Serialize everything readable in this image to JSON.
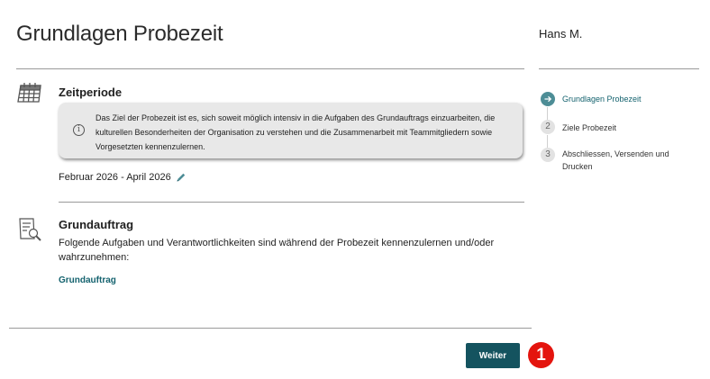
{
  "header": {
    "title": "Grundlagen Probezeit",
    "user": "Hans M."
  },
  "sections": {
    "period": {
      "heading": "Zeitperiode",
      "icon": "calendar-icon",
      "info_text": "Das Ziel der Probezeit ist es, sich soweit möglich intensiv in die Aufgaben des Grundauftrags einzuarbeiten, die kulturellen Besonderheiten der Organisation zu verstehen und die Zusammenarbeit mit Teammitgliedern sowie Vorgesetzten kennenzulernen.",
      "period_value": "Februar 2026 - April 2026"
    },
    "task": {
      "heading": "Grundauftrag",
      "icon": "task-search-icon",
      "description": "Folgende Aufgaben und Verantwortlichkeiten sind während der Probezeit kennenzulernen und/oder wahrzunehmen:",
      "link_label": "Grundauftrag"
    }
  },
  "actions": {
    "next_label": "Weiter",
    "marker_label": "1"
  },
  "stepper": {
    "steps": [
      {
        "number": "",
        "label": "Grundlagen Probezeit",
        "active": true
      },
      {
        "number": "2",
        "label": "Ziele Probezeit",
        "active": false
      },
      {
        "number": "3",
        "label": "Abschliessen, Versenden und Drucken",
        "active": false
      }
    ]
  },
  "colors": {
    "accent": "#14535f",
    "link": "#14626e",
    "step_active": "#4d8d96",
    "marker": "#e4140e"
  }
}
